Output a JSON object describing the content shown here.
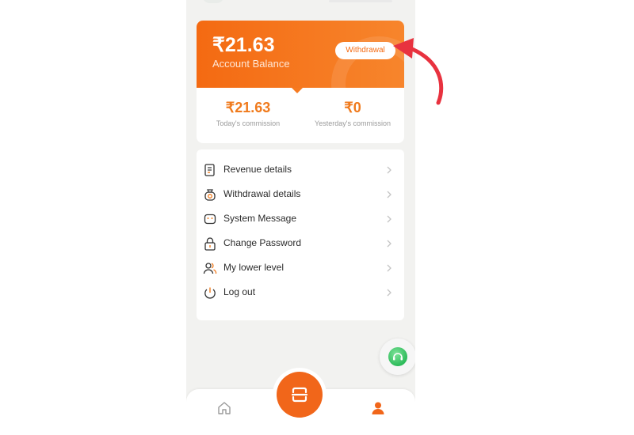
{
  "balance": {
    "amount": "₹21.63",
    "label": "Account Balance",
    "withdraw_label": "Withdrawal"
  },
  "commission": {
    "today_amount": "₹21.63",
    "today_label": "Today's commission",
    "yesterday_amount": "₹0",
    "yesterday_label": "Yesterday's commission"
  },
  "menu": {
    "items": [
      {
        "label": "Revenue details",
        "icon": "document-icon"
      },
      {
        "label": "Withdrawal details",
        "icon": "money-bag-icon"
      },
      {
        "label": "System Message",
        "icon": "message-icon"
      },
      {
        "label": "Change Password",
        "icon": "lock-icon"
      },
      {
        "label": "My lower level",
        "icon": "users-icon"
      },
      {
        "label": "Log out",
        "icon": "power-icon"
      }
    ]
  },
  "colors": {
    "accent": "#f46a12",
    "annotation_arrow": "#e8323f",
    "support": "#2dbb5a"
  }
}
